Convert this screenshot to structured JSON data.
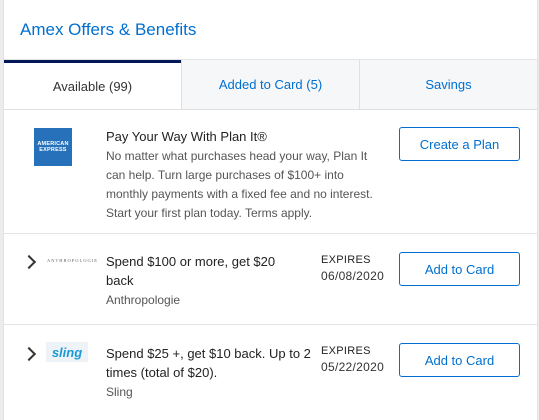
{
  "header": {
    "title": "Amex Offers & Benefits"
  },
  "tabs": [
    {
      "label": "Available (99)",
      "active": true
    },
    {
      "label": "Added to Card (5)",
      "active": false
    },
    {
      "label": "Savings",
      "active": false
    }
  ],
  "plan_it": {
    "logo_text_1": "AMERICAN",
    "logo_text_2": "EXPRESS",
    "title": "Pay Your Way With Plan It®",
    "description": "No matter what purchases head your way, Plan It can help. Turn large purchases of $100+ into monthly payments with a fixed fee and no interest. Start your first plan today. Terms apply.",
    "button_label": "Create a Plan"
  },
  "offers": [
    {
      "logo_text": "ANTHROPOLOGIE",
      "title": "Spend $100 or more, get $20 back",
      "merchant": "Anthropologie",
      "expires_label": "EXPIRES",
      "expires_date": "06/08/2020",
      "button_label": "Add to Card"
    },
    {
      "logo_text": "sling",
      "title": "Spend $25 +, get $10 back. Up to 2 times (total of $20).",
      "merchant": "Sling",
      "expires_label": "EXPIRES",
      "expires_date": "05/22/2020",
      "button_label": "Add to Card"
    }
  ],
  "colors": {
    "accent": "#006fcf",
    "amex_blue": "#2671b9",
    "sling_blue": "#1a9ad6",
    "tab_active_border": "#00175a"
  }
}
